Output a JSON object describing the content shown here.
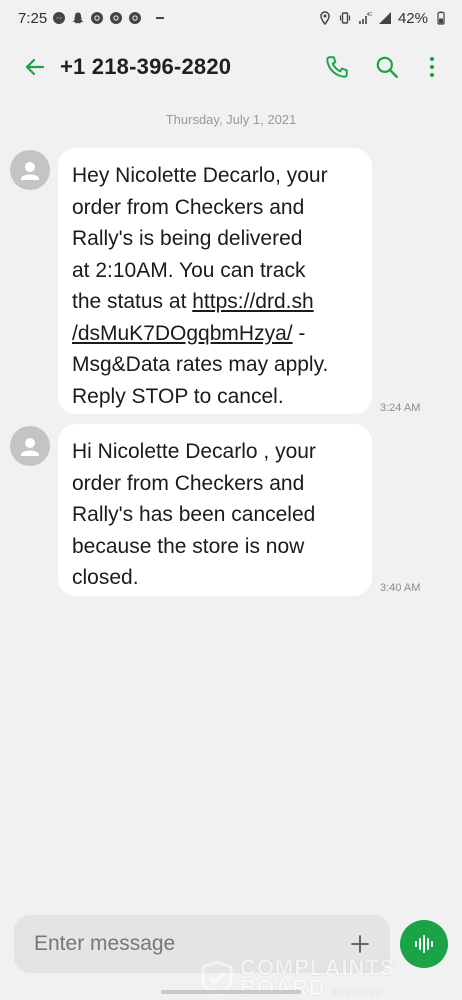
{
  "status_bar": {
    "time": "7:25",
    "battery": "42%",
    "left_icons": [
      "messenger-icon",
      "snapchat-icon",
      "chrome-icon",
      "chrome-icon",
      "chrome-icon",
      "more-notifications-icon"
    ],
    "right_icons": [
      "location-icon",
      "vibrate-icon",
      "wifi-icon",
      "signal-icon",
      "battery-icon"
    ]
  },
  "header": {
    "title": "+1 218-396-2820",
    "icons": [
      "back-arrow-icon",
      "phone-icon",
      "search-icon",
      "more-vert-icon"
    ]
  },
  "conversation": {
    "date": "Thursday, July 1, 2021",
    "messages": [
      {
        "lines": [
          "Hey Nicolette Decarlo, your",
          "order from Checkers and",
          "Rally's is being delivered",
          "at 2:10AM. You can track",
          "the status at "
        ],
        "link_part1": "https://drd.sh",
        "link_part2": "/dsMuK7DOgqbmHzya/",
        "after_link": " -",
        "tail_lines": [
          "Msg&Data rates may apply.",
          "Reply STOP to cancel."
        ],
        "time": "3:24 AM"
      },
      {
        "lines": [
          "Hi Nicolette Decarlo , your",
          "order from Checkers and",
          "Rally's has been canceled",
          "because the store is now",
          "closed."
        ],
        "time": "3:40 AM"
      }
    ]
  },
  "composer": {
    "placeholder": "Enter message",
    "icons": [
      "add-icon",
      "voice-icon"
    ]
  },
  "watermark": {
    "line1": "COMPLAINTS",
    "line2": "BOARD",
    "line3": "RESOLVED"
  },
  "colors": {
    "accent": "#1aa347",
    "background": "#f1f1f1",
    "bubble": "#ffffff"
  }
}
